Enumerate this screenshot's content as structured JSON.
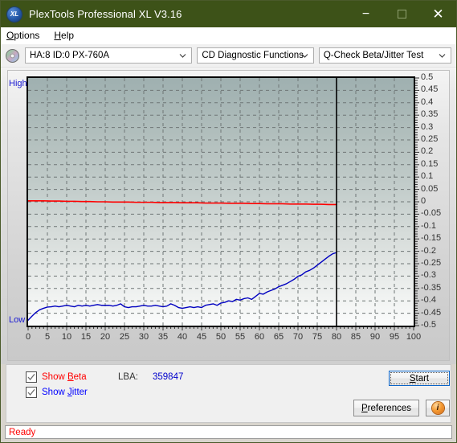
{
  "window": {
    "title": "PlexTools Professional XL V3.16",
    "icon": "XL",
    "icon_name": "plextools-logo-icon",
    "titlebar_color": "#3d5218",
    "buttons": {
      "minimize": "minimize-icon",
      "maximize": "maximize-icon",
      "close": "close-icon"
    }
  },
  "menubar": {
    "items": [
      {
        "label": "Options",
        "accel": "O"
      },
      {
        "label": "Help",
        "accel": "H"
      }
    ]
  },
  "toolbar": {
    "drive_icon": "cd-disc-icon",
    "selects": [
      {
        "name": "drive-select",
        "value": "HA:8 ID:0  PX-760A"
      },
      {
        "name": "function-select",
        "value": "CD Diagnostic Functions"
      },
      {
        "name": "test-select",
        "value": "Q-Check Beta/Jitter Test"
      }
    ]
  },
  "chart_data": {
    "type": "line",
    "title": "",
    "xlabel": "",
    "ylabel": "",
    "xlim": [
      0,
      100
    ],
    "ylim": [
      -0.5,
      0.5
    ],
    "xticks": [
      0,
      5,
      10,
      15,
      20,
      25,
      30,
      35,
      40,
      45,
      50,
      55,
      60,
      65,
      70,
      75,
      80,
      85,
      90,
      95,
      100
    ],
    "yticks": [
      0.5,
      0.45,
      0.4,
      0.35,
      0.3,
      0.25,
      0.2,
      0.15,
      0.1,
      0.05,
      0,
      -0.05,
      -0.1,
      -0.15,
      -0.2,
      -0.25,
      -0.3,
      -0.35,
      -0.4,
      -0.45,
      -0.5
    ],
    "grid": true,
    "grid_style": "dashed",
    "axis_labels": {
      "top_left": "High",
      "bottom_left": "Low"
    },
    "data_end_marker_x": 80,
    "series": [
      {
        "name": "Beta",
        "color": "#ff0000",
        "x": [
          0,
          2,
          4,
          6,
          8,
          10,
          12,
          14,
          16,
          18,
          20,
          22,
          24,
          26,
          28,
          30,
          32,
          34,
          36,
          38,
          40,
          42,
          44,
          46,
          48,
          50,
          52,
          54,
          56,
          58,
          60,
          62,
          64,
          66,
          68,
          70,
          72,
          74,
          76,
          78,
          80
        ],
        "values": [
          0.004,
          0.004,
          0.004,
          0.003,
          0.003,
          0.002,
          0.002,
          0.001,
          0.001,
          0.0,
          0.0,
          -0.001,
          -0.001,
          -0.001,
          -0.002,
          -0.002,
          -0.002,
          -0.003,
          -0.003,
          -0.003,
          -0.004,
          -0.004,
          -0.004,
          -0.005,
          -0.005,
          -0.005,
          -0.006,
          -0.006,
          -0.006,
          -0.007,
          -0.007,
          -0.008,
          -0.008,
          -0.008,
          -0.009,
          -0.009,
          -0.009,
          -0.01,
          -0.01,
          -0.011,
          -0.011
        ]
      },
      {
        "name": "Jitter",
        "color": "#0000c0",
        "x": [
          0,
          1,
          2,
          3,
          4,
          5,
          6,
          7,
          8,
          9,
          10,
          11,
          12,
          13,
          14,
          15,
          16,
          17,
          18,
          19,
          20,
          21,
          22,
          23,
          24,
          25,
          26,
          27,
          28,
          29,
          30,
          31,
          32,
          33,
          34,
          35,
          36,
          37,
          38,
          39,
          40,
          41,
          42,
          43,
          44,
          45,
          46,
          47,
          48,
          49,
          50,
          51,
          52,
          53,
          54,
          55,
          56,
          57,
          58,
          59,
          60,
          61,
          62,
          63,
          64,
          65,
          66,
          67,
          68,
          69,
          70,
          71,
          72,
          73,
          74,
          75,
          76,
          77,
          78,
          79,
          80
        ],
        "values": [
          -0.478,
          -0.462,
          -0.447,
          -0.436,
          -0.43,
          -0.425,
          -0.424,
          -0.421,
          -0.424,
          -0.421,
          -0.418,
          -0.421,
          -0.424,
          -0.418,
          -0.421,
          -0.418,
          -0.421,
          -0.418,
          -0.415,
          -0.418,
          -0.418,
          -0.418,
          -0.421,
          -0.418,
          -0.412,
          -0.424,
          -0.427,
          -0.424,
          -0.424,
          -0.421,
          -0.418,
          -0.421,
          -0.421,
          -0.418,
          -0.421,
          -0.424,
          -0.421,
          -0.412,
          -0.418,
          -0.427,
          -0.43,
          -0.427,
          -0.424,
          -0.427,
          -0.424,
          -0.427,
          -0.418,
          -0.415,
          -0.412,
          -0.418,
          -0.409,
          -0.406,
          -0.4,
          -0.403,
          -0.394,
          -0.397,
          -0.391,
          -0.388,
          -0.394,
          -0.382,
          -0.37,
          -0.373,
          -0.364,
          -0.358,
          -0.352,
          -0.343,
          -0.337,
          -0.331,
          -0.322,
          -0.313,
          -0.301,
          -0.295,
          -0.283,
          -0.277,
          -0.268,
          -0.256,
          -0.244,
          -0.232,
          -0.22,
          -0.21,
          -0.205
        ]
      }
    ]
  },
  "controls": {
    "show_beta": {
      "label_pre": "Show ",
      "label_accel": "B",
      "label_post": "eta",
      "checked": true,
      "color": "#ff0000"
    },
    "show_jitter": {
      "label_pre": "Show ",
      "label_accel": "J",
      "label_post": "itter",
      "checked": true,
      "color": "#0000ff"
    },
    "lba_label": "LBA:",
    "lba_value": "359847",
    "start_button": {
      "pre": "",
      "accel": "S",
      "post": "tart"
    },
    "preferences_button": {
      "pre": "",
      "accel": "P",
      "post": "references"
    },
    "info_button": {
      "icon": "info-icon",
      "glyph": "i"
    }
  },
  "statusbar": {
    "text": "Ready",
    "color": "#ff0000"
  }
}
